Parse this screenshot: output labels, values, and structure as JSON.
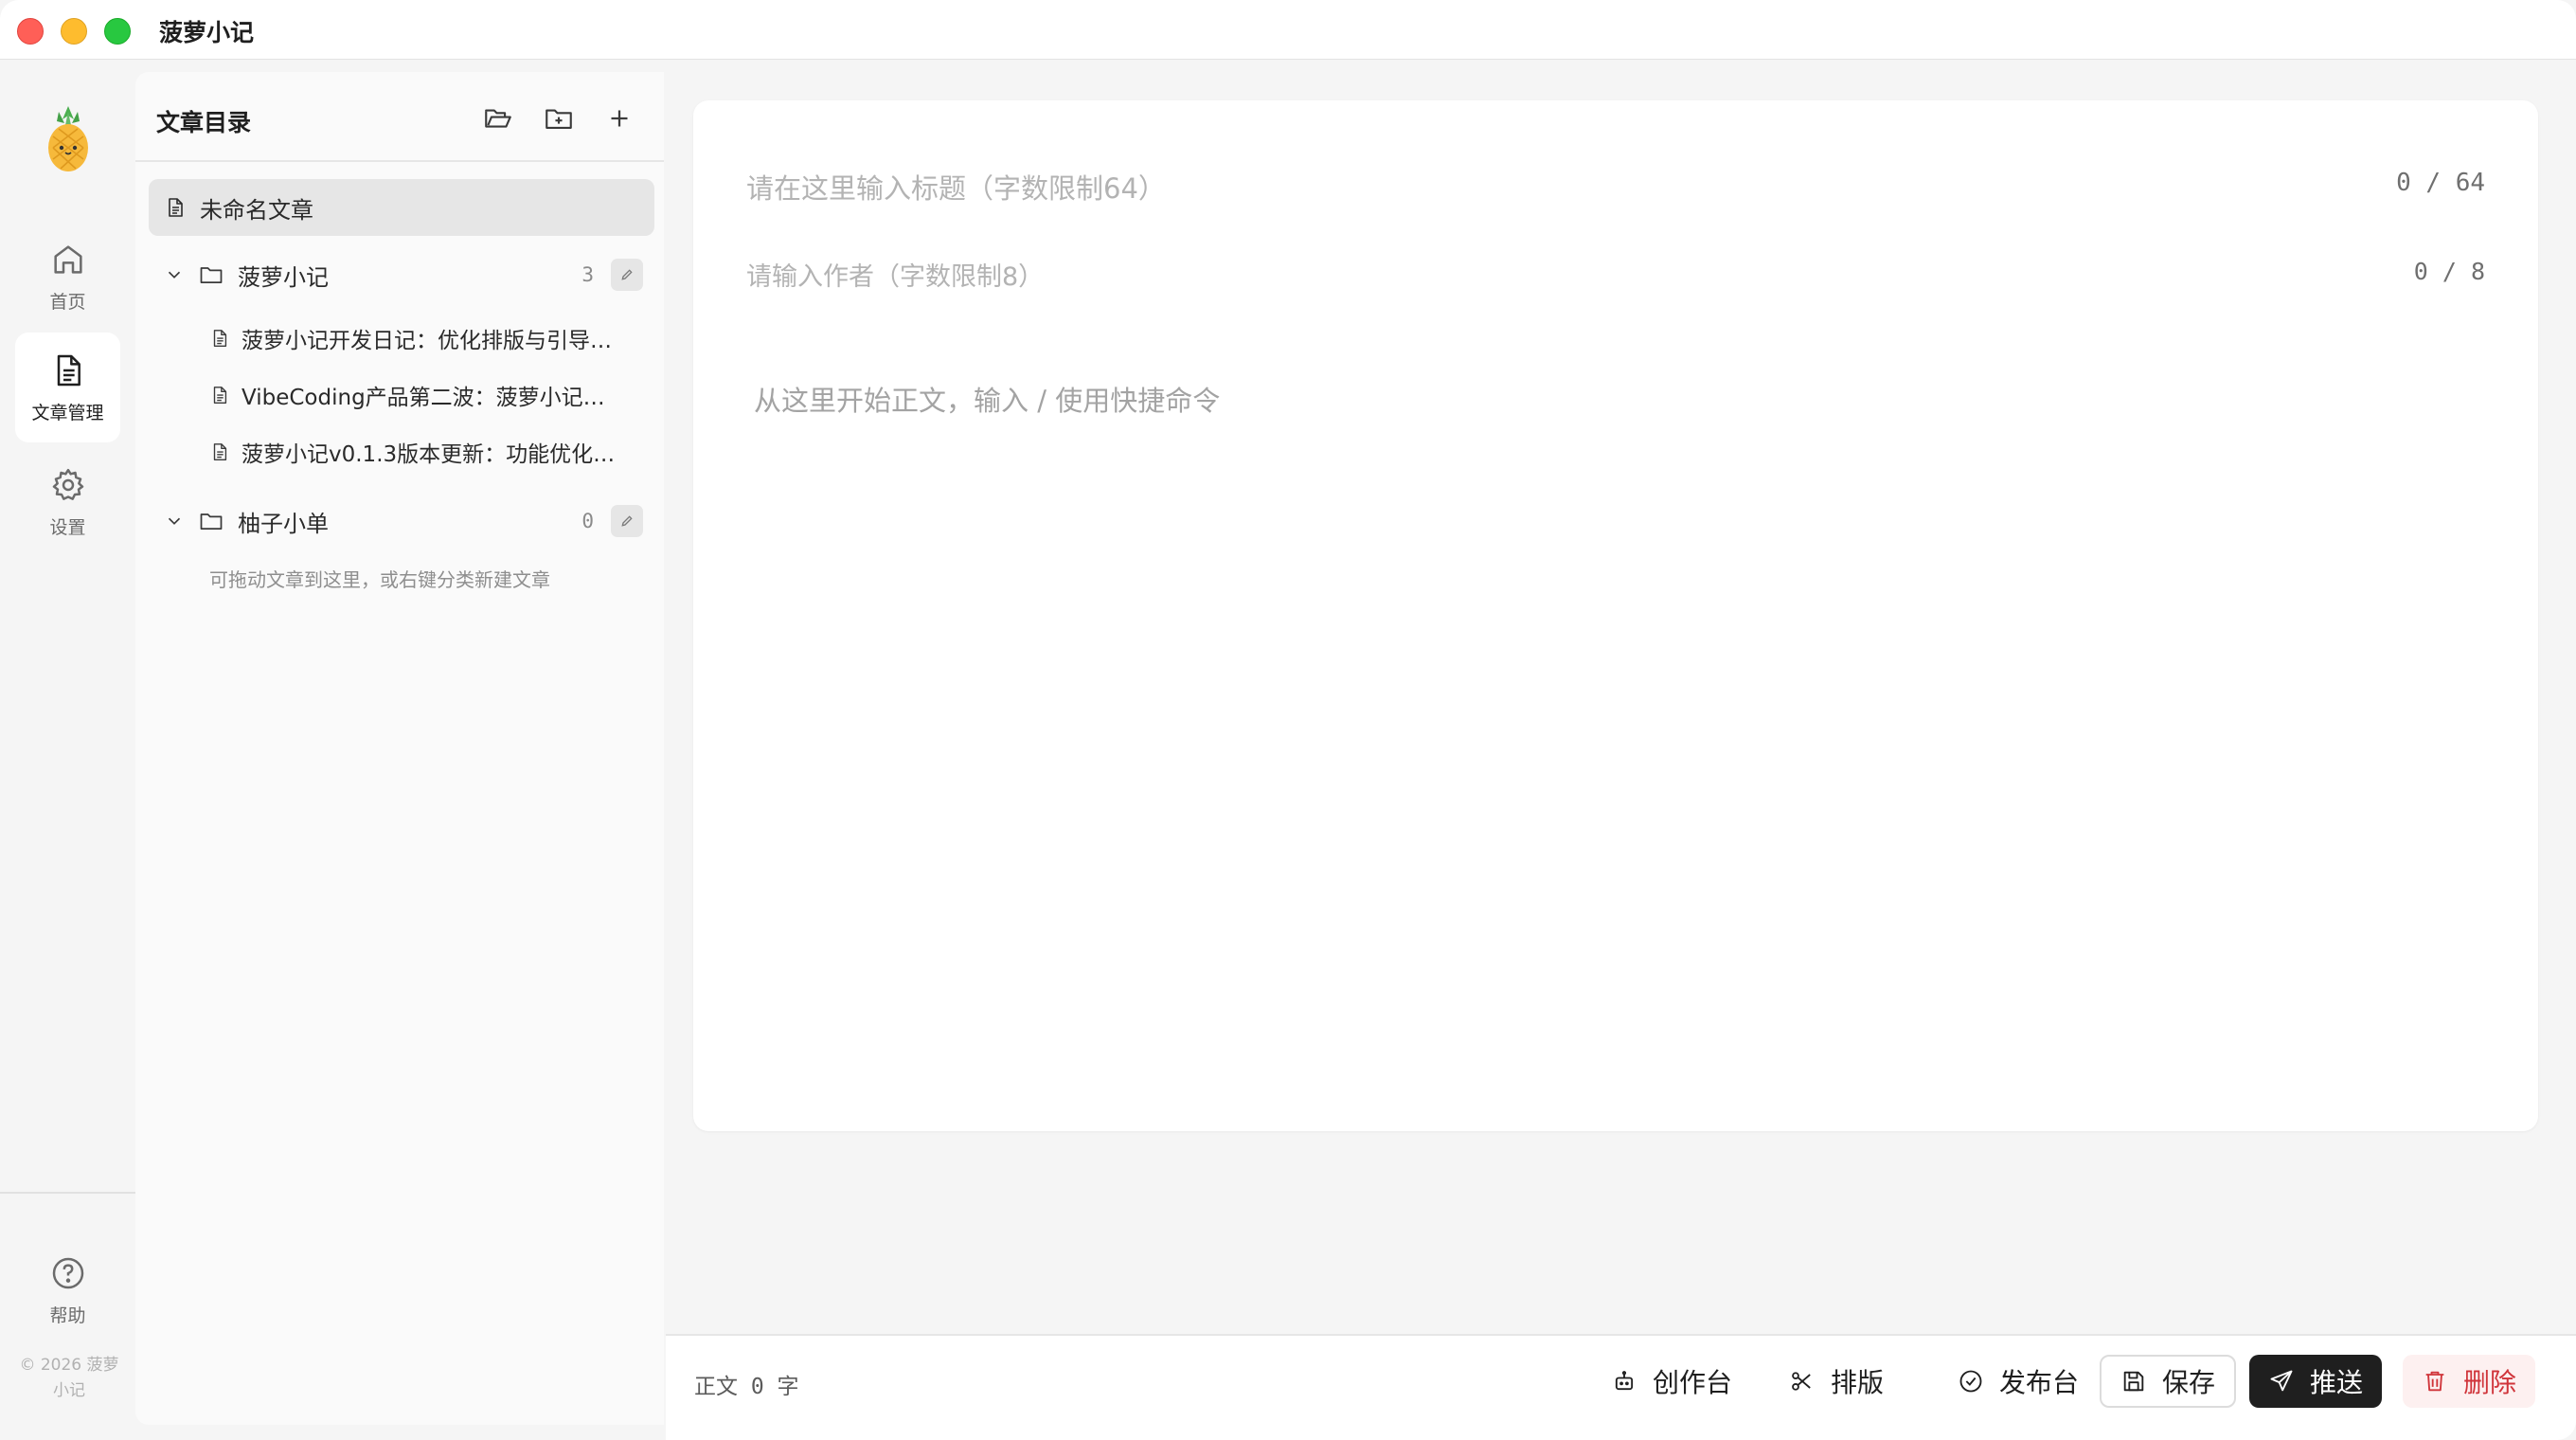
{
  "app": {
    "title": "菠萝小记"
  },
  "rail": {
    "items": [
      {
        "label": "首页"
      },
      {
        "label": "文章管理"
      },
      {
        "label": "设置"
      }
    ],
    "help_label": "帮助",
    "copyright": "© 2026 菠萝小记"
  },
  "directory": {
    "title": "文章目录",
    "current_doc": "未命名文章",
    "folders": [
      {
        "name": "菠萝小记",
        "count": "3",
        "docs": [
          "菠萝小记开发日记：优化排版与引导…",
          "VibeCoding产品第二波：菠萝小记…",
          "菠萝小记v0.1.3版本更新：功能优化…"
        ]
      },
      {
        "name": "柚子小单",
        "count": "0",
        "hint": "可拖动文章到这里，或右键分类新建文章"
      }
    ]
  },
  "editor": {
    "title_placeholder": "请在这里输入标题（字数限制64）",
    "title_count": "0 / 64",
    "author_placeholder": "请输入作者（字数限制8）",
    "author_count": "0 / 8",
    "body_placeholder": "从这里开始正文，输入 / 使用快捷命令"
  },
  "footer": {
    "word_count": "正文 0 字",
    "buttons": {
      "studio": "创作台",
      "layout": "排版",
      "publish": "发布台",
      "save": "保存",
      "push": "推送",
      "delete": "删除"
    }
  },
  "colors": {
    "push_bg": "#1f1f1f",
    "delete_text": "#d0343a",
    "delete_bg": "#fdf0f0",
    "selected_row_bg": "#e6e6e6"
  }
}
